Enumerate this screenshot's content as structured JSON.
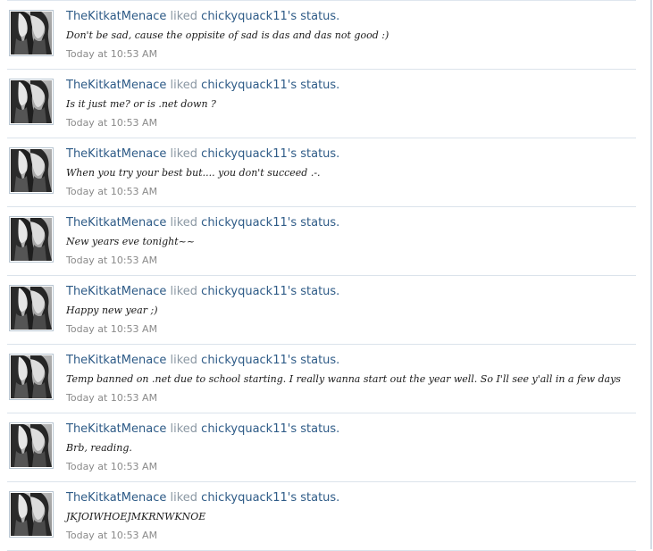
{
  "feed": {
    "items": [
      {
        "actor": "TheKitkatMenace",
        "action": "liked",
        "target": "chickyquack11's status.",
        "status": "Don't be sad, cause the oppisite of sad is das and das not good :)",
        "time": "Today at 10:53 AM",
        "avatar_icon": "user-avatar-icon"
      },
      {
        "actor": "TheKitkatMenace",
        "action": "liked",
        "target": "chickyquack11's status.",
        "status": "Is it just me? or is .net down ?",
        "time": "Today at 10:53 AM",
        "avatar_icon": "user-avatar-icon"
      },
      {
        "actor": "TheKitkatMenace",
        "action": "liked",
        "target": "chickyquack11's status.",
        "status": "When you try your best but.... you don't succeed .-.",
        "time": "Today at 10:53 AM",
        "avatar_icon": "user-avatar-icon"
      },
      {
        "actor": "TheKitkatMenace",
        "action": "liked",
        "target": "chickyquack11's status.",
        "status": "New years eve tonight~~",
        "time": "Today at 10:53 AM",
        "avatar_icon": "user-avatar-icon"
      },
      {
        "actor": "TheKitkatMenace",
        "action": "liked",
        "target": "chickyquack11's status.",
        "status": "Happy new year ;)",
        "time": "Today at 10:53 AM",
        "avatar_icon": "user-avatar-icon"
      },
      {
        "actor": "TheKitkatMenace",
        "action": "liked",
        "target": "chickyquack11's status.",
        "status": "Temp banned on .net due to school starting. I really wanna start out the year well. So I'll see y'all in a few days",
        "time": "Today at 10:53 AM",
        "avatar_icon": "user-avatar-icon"
      },
      {
        "actor": "TheKitkatMenace",
        "action": "liked",
        "target": "chickyquack11's status.",
        "status": "Brb, reading.",
        "time": "Today at 10:53 AM",
        "avatar_icon": "user-avatar-icon"
      },
      {
        "actor": "TheKitkatMenace",
        "action": "liked",
        "target": "chickyquack11's status.",
        "status": "JKJOIWHOEJMKRNWKNOE",
        "time": "Today at 10:53 AM",
        "avatar_icon": "user-avatar-icon"
      }
    ]
  },
  "colors": {
    "link": "#2e5b87",
    "muted": "#8a97a3",
    "divider": "#dbe3eb",
    "timestamp": "#8a8a8a"
  }
}
